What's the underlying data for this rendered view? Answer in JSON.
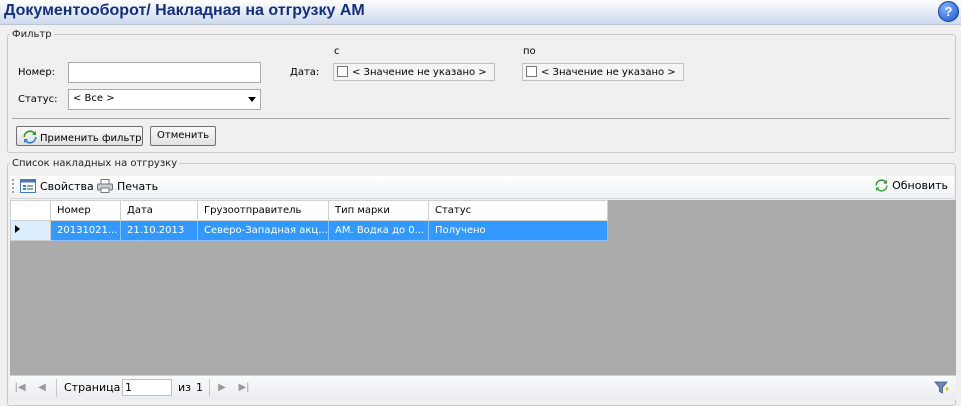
{
  "window": {
    "title": "Документооборот/ Накладная на отгрузку АМ",
    "help_label": "?"
  },
  "filter": {
    "legend": "Фильтр",
    "number_label": "Номер:",
    "number_value": "",
    "status_label": "Статус:",
    "status_value": "< Все >",
    "date_label": "Дата:",
    "from_label": "с",
    "to_label": "по",
    "from_value": "< Значение не указано >",
    "to_value": "< Значение не указано >",
    "apply_button": "Применить фильтр",
    "cancel_button": "Отменить"
  },
  "list": {
    "legend": "Список накладных на отгрузку",
    "toolbar": {
      "properties": "Свойства",
      "print": "Печать",
      "refresh": "Обновить"
    },
    "columns": [
      "Номер",
      "Дата",
      "Грузоотправитель",
      "Тип марки",
      "Статус"
    ],
    "rows": [
      [
        "20131021...",
        "21.10.2013",
        "Северо-Западная акц...",
        "АМ. Водка до 0...",
        "Получено"
      ]
    ]
  },
  "pager": {
    "page_label": "Страница",
    "page_value": "1",
    "of_label": "из",
    "total_pages": "1"
  },
  "colors": {
    "title": "#13307a",
    "selection": "#3399ff",
    "empty_grid": "#ababab"
  },
  "icons": [
    "help-icon",
    "apply-filter-icon",
    "properties-icon",
    "print-icon",
    "refresh-icon",
    "first-page-icon",
    "prev-page-icon",
    "next-page-icon",
    "last-page-icon",
    "filter-settings-icon"
  ]
}
